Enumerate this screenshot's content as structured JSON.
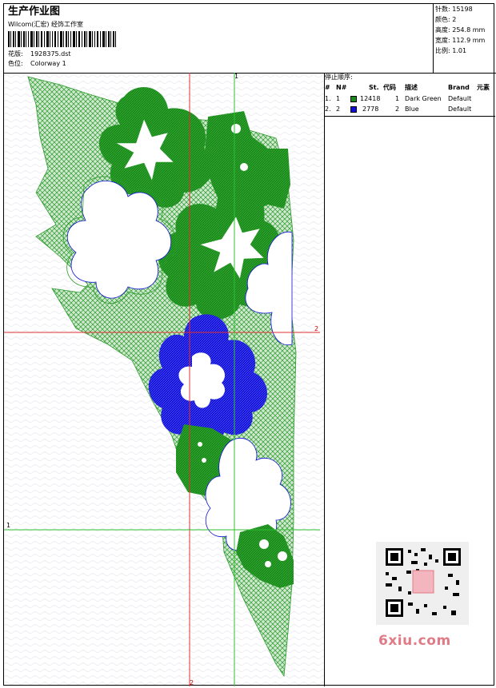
{
  "header": {
    "title": "生产作业图",
    "company": "Wilcom(汇宏) 经饰工作室",
    "design_label": "花版:",
    "design_value": "1928375.dst",
    "colorway_label": "色位:",
    "colorway_value": "Colorway 1"
  },
  "stats": [
    {
      "label": "针数:",
      "value": "15198"
    },
    {
      "label": "颜色:",
      "value": "2"
    },
    {
      "label": "高度:",
      "value": "254.8 mm"
    },
    {
      "label": "宽度:",
      "value": "112.9 mm"
    },
    {
      "label": "比例:",
      "value": "1.01"
    }
  ],
  "stop_sequence": {
    "title": "停止顺序:",
    "columns": [
      "#",
      "N#",
      "St.",
      "代码",
      "描述",
      "Brand",
      "元素"
    ],
    "rows": [
      {
        "index": "1.",
        "n": "1",
        "color": "#1a8a1a",
        "stitches": "12418",
        "code": "1",
        "description": "Dark Green",
        "brand": "Default"
      },
      {
        "index": "2.",
        "n": "2",
        "color": "#1010d8",
        "stitches": "2778",
        "code": "2",
        "description": "Blue",
        "brand": "Default"
      }
    ]
  },
  "guides": {
    "top_label": "1",
    "right_label": "2",
    "bottom_label": "2",
    "left_label": "1"
  },
  "colors": {
    "dark_green": "#1a8a1a",
    "light_green": "#8cc98c",
    "blue": "#1010d8",
    "guide_red": "#e03030",
    "guide_green": "#30c030"
  },
  "watermark": "6xiu.com"
}
